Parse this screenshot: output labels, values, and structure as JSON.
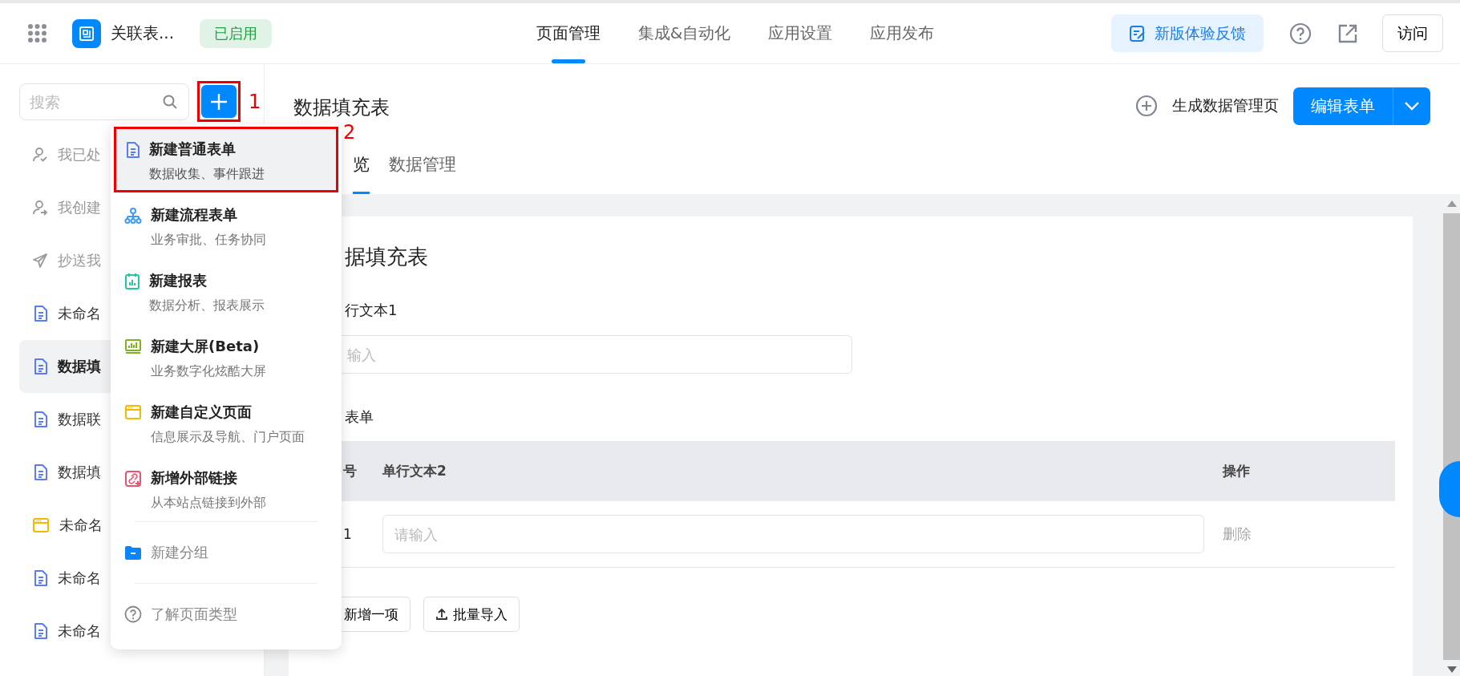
{
  "top_bar": {
    "app_name": "关联表...",
    "status_badge": "已启用",
    "nav_tabs": [
      {
        "label": "页面管理",
        "selected": true
      },
      {
        "label": "集成&自动化",
        "selected": false
      },
      {
        "label": "应用设置",
        "selected": false
      },
      {
        "label": "应用发布",
        "selected": false
      }
    ],
    "feedback_button": "新版体验反馈",
    "visit_button": "访问"
  },
  "sidebar": {
    "search": {
      "placeholder": "搜索"
    },
    "add_button_annotation": "1",
    "items": [
      {
        "label": "我已处",
        "kind": "approved",
        "selected": false
      },
      {
        "label": "我创建",
        "kind": "created",
        "selected": false
      },
      {
        "label": "抄送我",
        "kind": "cc",
        "selected": false
      },
      {
        "label": "未命名",
        "kind": "form",
        "selected": false
      },
      {
        "label": "数据填",
        "kind": "form",
        "selected": true
      },
      {
        "label": "数据联",
        "kind": "form",
        "selected": false
      },
      {
        "label": "数据填",
        "kind": "form",
        "selected": false
      },
      {
        "label": "未命名",
        "kind": "page",
        "selected": false
      },
      {
        "label": "未命名",
        "kind": "form",
        "selected": false
      },
      {
        "label": "未命名",
        "kind": "form",
        "selected": false
      }
    ]
  },
  "add_menu": {
    "items": [
      {
        "kind": "form",
        "title": "新建普通表单",
        "subtitle": "数据收集、事件跟进",
        "highlighted": true,
        "annotation": "2"
      },
      {
        "kind": "flow",
        "title": "新建流程表单",
        "subtitle": "业务审批、任务协同",
        "highlighted": false
      },
      {
        "kind": "report",
        "title": "新建报表",
        "subtitle": "数据分析、报表展示",
        "highlighted": false
      },
      {
        "kind": "screen",
        "title": "新建大屏(Beta)",
        "subtitle": "业务数字化炫酷大屏",
        "highlighted": false
      },
      {
        "kind": "custom",
        "title": "新建自定义页面",
        "subtitle": "信息展示及导航、门户页面",
        "highlighted": false
      },
      {
        "kind": "link",
        "title": "新增外部链接",
        "subtitle": "从本站点链接到外部",
        "highlighted": false
      }
    ],
    "group_item": "新建分组",
    "help_item": "了解页面类型"
  },
  "page": {
    "title": "数据填充表",
    "generate_button": "生成数据管理页",
    "edit_button": "编辑表单",
    "tabs": [
      {
        "label": "览",
        "selected": true
      },
      {
        "label": "数据管理",
        "selected": false
      }
    ],
    "form": {
      "title": "据填充表",
      "field": {
        "label": "行文本1",
        "placeholder": "输入"
      },
      "subform": {
        "label": "表单",
        "columns": [
          "号",
          "单行文本2",
          "操作"
        ],
        "rows": [
          {
            "index": "1",
            "placeholder": "请输入",
            "action": "删除"
          }
        ],
        "add_button": "新增一项",
        "import_button": "批量导入"
      }
    }
  }
}
